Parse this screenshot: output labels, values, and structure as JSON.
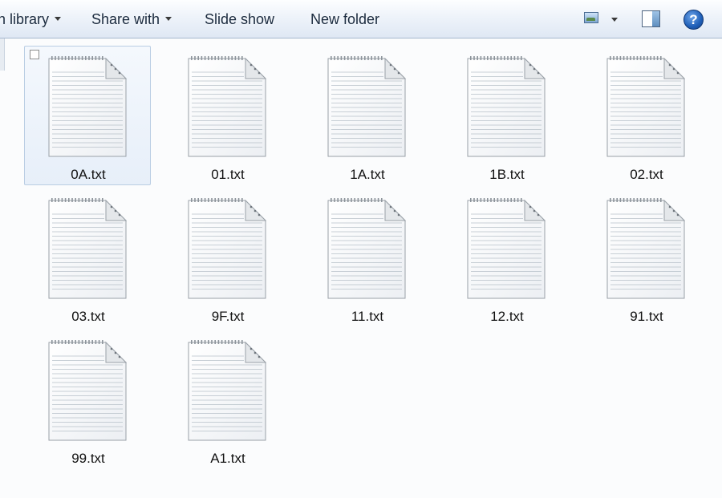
{
  "toolbar": {
    "include_in_library": "n library",
    "share_with": "Share with",
    "slide_show": "Slide show",
    "new_folder": "New folder",
    "views_icon": "change-view-icon",
    "preview_pane_icon": "preview-pane-icon",
    "help_icon": "help-icon",
    "help_glyph": "?"
  },
  "files": [
    {
      "name": "0A.txt",
      "selected": true
    },
    {
      "name": "01.txt"
    },
    {
      "name": "1A.txt"
    },
    {
      "name": "1B.txt"
    },
    {
      "name": "02.txt"
    },
    {
      "name": "03.txt"
    },
    {
      "name": "9F.txt"
    },
    {
      "name": "11.txt"
    },
    {
      "name": "12.txt"
    },
    {
      "name": "91.txt"
    },
    {
      "name": "99.txt"
    },
    {
      "name": "A1.txt"
    }
  ],
  "colors": {
    "toolbar_text": "#1a2a3e",
    "selection_border": "#b9cde3",
    "help_blue": "#1f5fb8"
  }
}
